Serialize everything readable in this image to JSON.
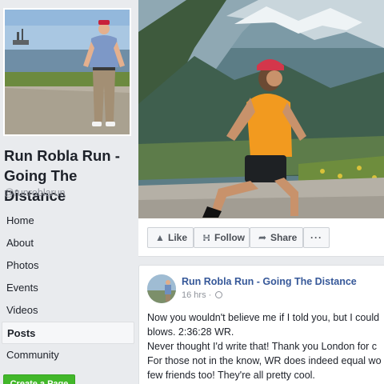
{
  "page": {
    "name": "Run Robla Run - Going The Distance",
    "name_line1": "Run Robla Run -",
    "name_line2": "Going The Distance",
    "handle": "@runroblarun"
  },
  "nav": {
    "items": [
      {
        "label": "Home"
      },
      {
        "label": "About"
      },
      {
        "label": "Photos"
      },
      {
        "label": "Events"
      },
      {
        "label": "Videos"
      },
      {
        "label": "Posts",
        "active": true
      },
      {
        "label": "Community"
      }
    ],
    "create_page_label": "Create a Page"
  },
  "actions": {
    "like_label": "Like",
    "follow_label": "Follow",
    "share_label": "Share",
    "more_label": "···"
  },
  "post": {
    "author": "Run Robla Run - Going The Distance",
    "time": "16 hrs",
    "separator": "·",
    "body_lines": [
      "Now you wouldn't believe me if I told you, but I could",
      "blows. 2:36:28 WR.",
      "Never thought I'd write that! Thank you London for c",
      "For those not in the know, WR does indeed equal wo",
      "few friends too! They're all pretty cool."
    ]
  },
  "colors": {
    "link_blue": "#365899",
    "create_green": "#42b72a",
    "background": "#e9ebee"
  },
  "icons": {
    "like": "thumbs-up-icon",
    "follow": "rss-icon",
    "share": "share-arrow-icon",
    "privacy": "globe-icon"
  }
}
